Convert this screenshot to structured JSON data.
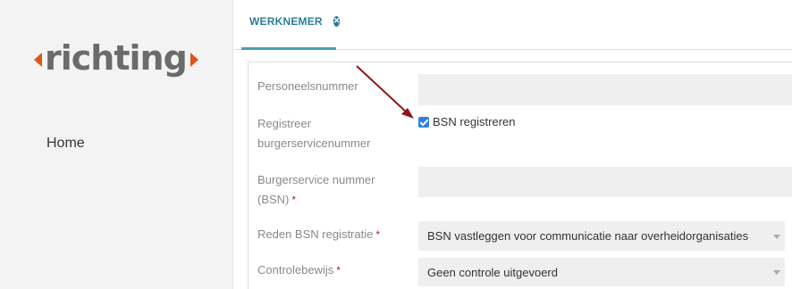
{
  "sidebar": {
    "logo_text": "richting",
    "nav_items": [
      {
        "label": "Home"
      }
    ]
  },
  "tabs": [
    {
      "label": "WERKNEMER",
      "close_icon": "close-circle-icon"
    }
  ],
  "form": {
    "personeelsnummer": {
      "label": "Personeelsnummer",
      "value": ""
    },
    "registreer_bsn": {
      "label_line1": "Registreer",
      "label_line2": "burgerservicenummer",
      "checkbox_label": "BSN registreren",
      "checked": true
    },
    "bsn": {
      "label_line1": "Burgerservice nummer",
      "label_line2": "(BSN)",
      "required_mark": "*",
      "value": ""
    },
    "reden_bsn": {
      "label": "Reden BSN registratie",
      "required_mark": "*",
      "value": "BSN vastleggen voor communicatie naar overheidorganisaties"
    },
    "controlebewijs": {
      "label": "Controlebewijs",
      "required_mark": "*",
      "value": "Geen controle uitgevoerd"
    }
  },
  "annotation": {
    "color": "#8b1a1a",
    "icon": "annotation-arrow"
  },
  "colors": {
    "accent": "#2c7d99",
    "tab_underline": "#4a9fb5",
    "logo_arrows": "#e0531a",
    "checkbox": "#2f7fe0",
    "required": "#b22222"
  }
}
